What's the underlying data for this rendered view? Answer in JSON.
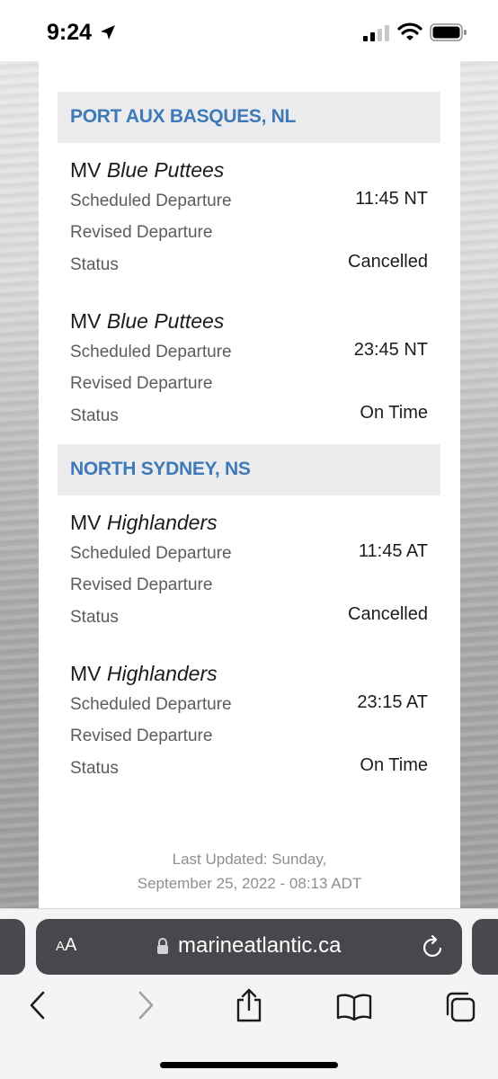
{
  "status_bar": {
    "time": "9:24",
    "icons": [
      "location-arrow-icon",
      "cellular-signal-icon",
      "wifi-icon",
      "battery-icon"
    ]
  },
  "ports": [
    {
      "name": "PORT AUX BASQUES, NL",
      "sailings": [
        {
          "vessel_prefix": "MV",
          "vessel_name": "Blue Puttees",
          "scheduled_label": "Scheduled Departure",
          "scheduled_value": "11:45 NT",
          "revised_label": "Revised Departure",
          "revised_value": "",
          "status_label": "Status",
          "status_value": "Cancelled"
        },
        {
          "vessel_prefix": "MV",
          "vessel_name": "Blue Puttees",
          "scheduled_label": "Scheduled Departure",
          "scheduled_value": "23:45 NT",
          "revised_label": "Revised Departure",
          "revised_value": "",
          "status_label": "Status",
          "status_value": "On Time"
        }
      ]
    },
    {
      "name": "NORTH SYDNEY, NS",
      "sailings": [
        {
          "vessel_prefix": "MV",
          "vessel_name": "Highlanders",
          "scheduled_label": "Scheduled Departure",
          "scheduled_value": "11:45 AT",
          "revised_label": "Revised Departure",
          "revised_value": "",
          "status_label": "Status",
          "status_value": "Cancelled"
        },
        {
          "vessel_prefix": "MV",
          "vessel_name": "Highlanders",
          "scheduled_label": "Scheduled Departure",
          "scheduled_value": "23:15 AT",
          "revised_label": "Revised Departure",
          "revised_value": "",
          "status_label": "Status",
          "status_value": "On Time"
        }
      ]
    }
  ],
  "footer": {
    "last_updated_line1": "Last Updated: Sunday,",
    "last_updated_line2": "September 25, 2022 - 08:13 ADT"
  },
  "browser": {
    "aa_small": "A",
    "aa_large": "A",
    "url": "marineatlantic.ca",
    "toolbar_icons": [
      "back-icon",
      "forward-icon",
      "share-icon",
      "bookmarks-icon",
      "tabs-icon"
    ]
  },
  "colors": {
    "port_header_text": "#3f7ab8",
    "port_header_bg": "#ececee",
    "address_bar_bg": "#48484c"
  }
}
